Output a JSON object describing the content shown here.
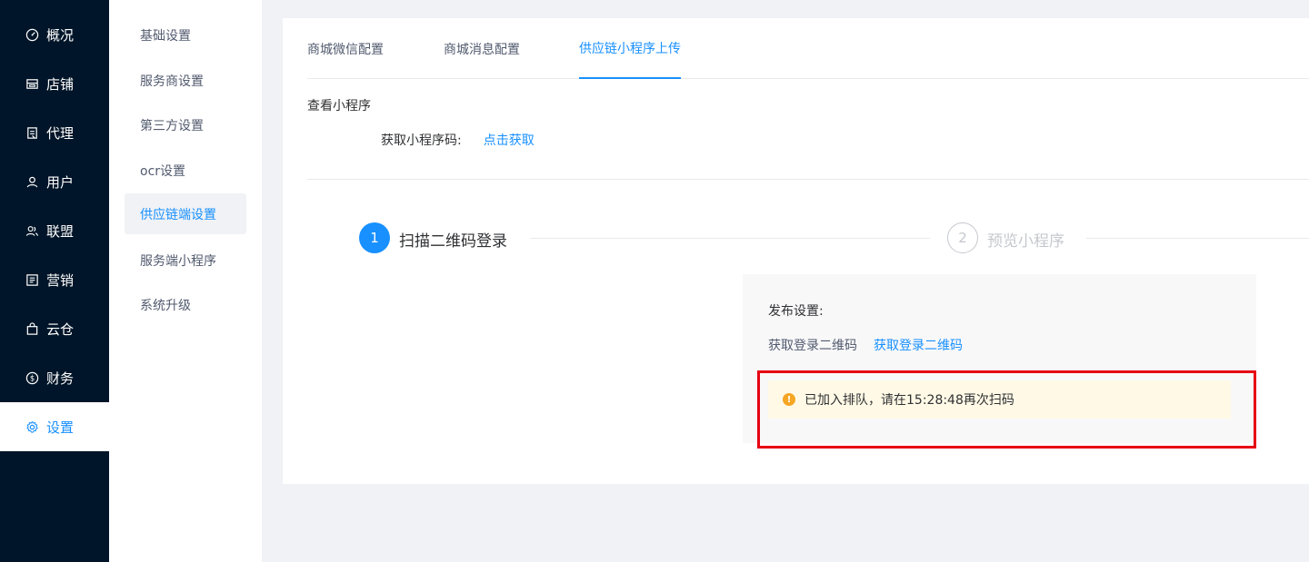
{
  "nav": {
    "items": [
      {
        "label": "概况",
        "icon": "dashboard-icon"
      },
      {
        "label": "店铺",
        "icon": "shop-icon"
      },
      {
        "label": "代理",
        "icon": "agent-icon"
      },
      {
        "label": "用户",
        "icon": "user-icon"
      },
      {
        "label": "联盟",
        "icon": "team-icon"
      },
      {
        "label": "营销",
        "icon": "marketing-icon"
      },
      {
        "label": "云仓",
        "icon": "bag-icon"
      },
      {
        "label": "财务",
        "icon": "dollar-icon"
      },
      {
        "label": "设置",
        "icon": "gear-icon",
        "active": true
      }
    ]
  },
  "submenu": {
    "items": [
      {
        "label": "基础设置"
      },
      {
        "label": "服务商设置"
      },
      {
        "label": "第三方设置"
      },
      {
        "label": "ocr设置"
      },
      {
        "label": "供应链端设置",
        "active": true
      },
      {
        "label": "服务端小程序"
      },
      {
        "label": "系统升级"
      }
    ]
  },
  "tabs": [
    {
      "label": "商城微信配置"
    },
    {
      "label": "商城消息配置"
    },
    {
      "label": "供应链小程序上传",
      "active": true
    }
  ],
  "view": {
    "title": "查看小程序",
    "qr_label": "获取小程序码:",
    "qr_link": "点击获取"
  },
  "steps": [
    {
      "number": "1",
      "title": "扫描二维码登录",
      "active": true
    },
    {
      "number": "2",
      "title": "预览小程序",
      "active": false
    }
  ],
  "publish": {
    "title": "发布设置:",
    "qr_label": "获取登录二维码",
    "qr_link": "获取登录二维码",
    "alert_text": "已加入排队，请在15:28:48再次扫码"
  },
  "colors": {
    "accent": "#1890ff",
    "nav_bg": "#001529",
    "warning": "#f5a623",
    "highlight": "#e60012"
  }
}
